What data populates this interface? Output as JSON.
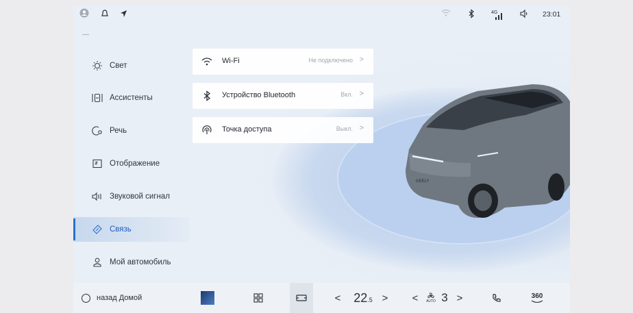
{
  "status": {
    "time": "23:01",
    "signal": "4G"
  },
  "sidebar": {
    "items": [
      {
        "label": "Свет",
        "icon": "sun-icon"
      },
      {
        "label": "Ассистенты",
        "icon": "assist-icon"
      },
      {
        "label": "Речь",
        "icon": "voice-icon"
      },
      {
        "label": "Отображение",
        "icon": "display-icon"
      },
      {
        "label": "Звуковой сигнал",
        "icon": "sound-icon"
      },
      {
        "label": "Связь",
        "icon": "link-icon",
        "active": true
      },
      {
        "label": "Мой автомобиль",
        "icon": "person-icon"
      }
    ]
  },
  "cards": [
    {
      "title": "Wi-Fi",
      "value": "Не подключено"
    },
    {
      "title": "Устройство Bluetooth",
      "value": "Вкл."
    },
    {
      "title": "Точка доступа",
      "value": "Выкл."
    }
  ],
  "car_badge": "GEELY",
  "bottom": {
    "home_label": "назад Домой",
    "temp": "22",
    "temp_decimal": ".5",
    "fan_auto": "AUTO",
    "fan_level": "3",
    "cam_label": "360"
  },
  "colors": {
    "accent": "#2a6fd1",
    "bg": "#e9eff6"
  }
}
